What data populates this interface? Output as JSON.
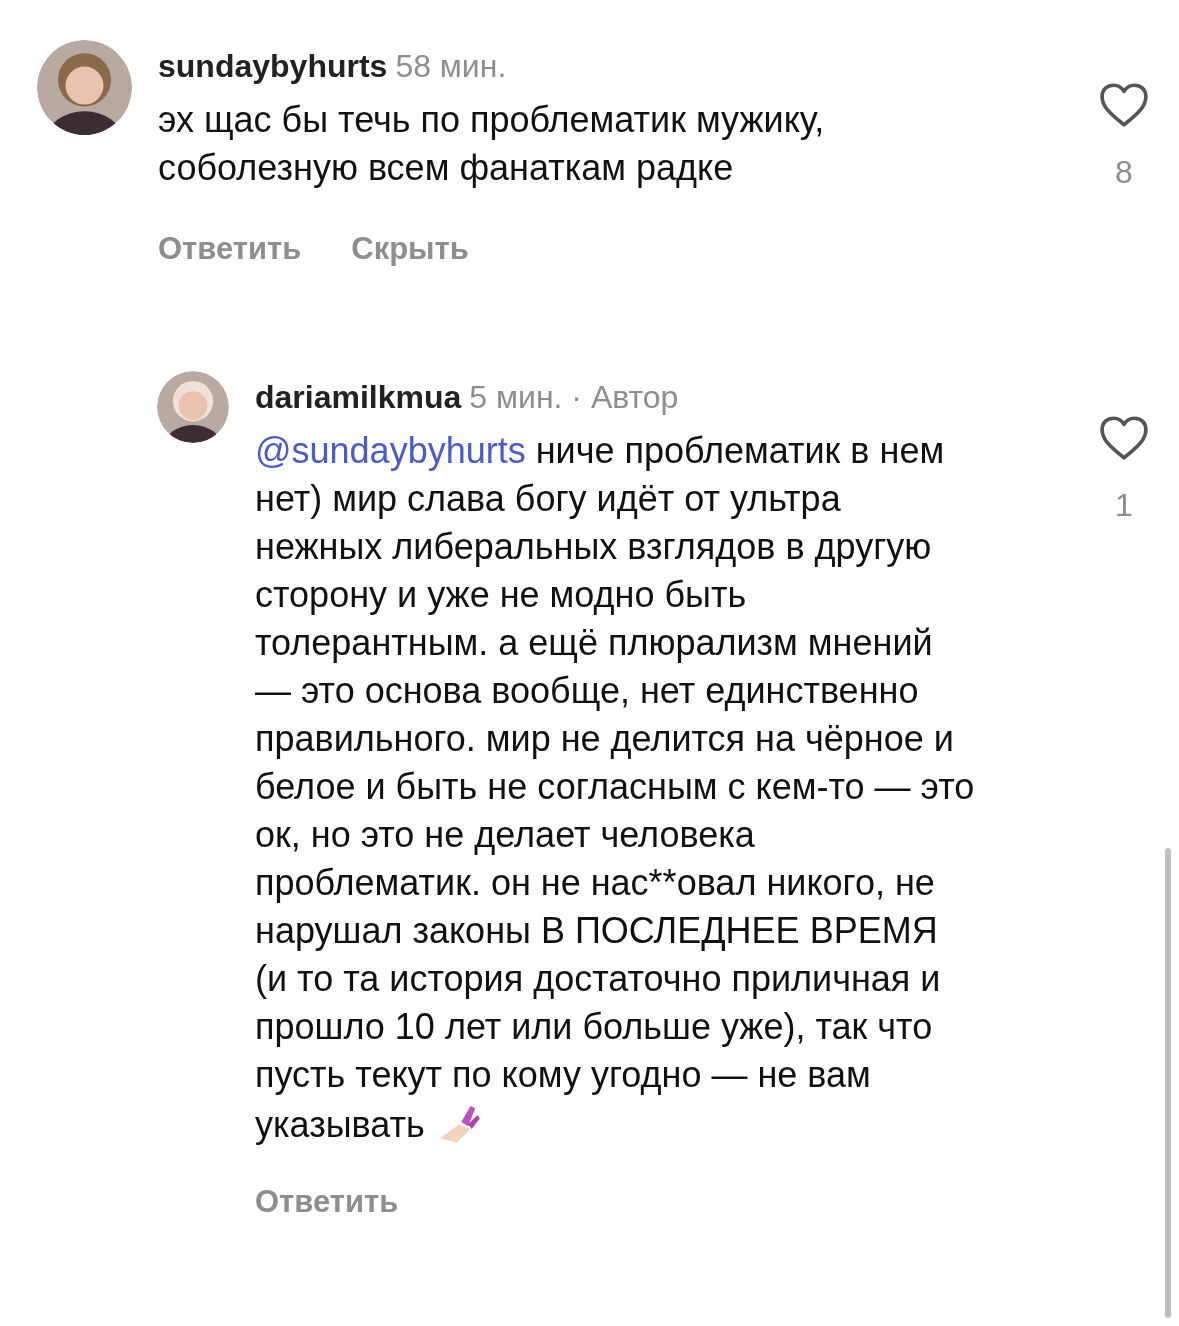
{
  "comments": [
    {
      "username": "sundaybyhurts",
      "meta": "58 мин.",
      "text": "эх щас бы течь по проблематик мужику, соболезную всем фанаткам радке",
      "likes": "8",
      "liked": false,
      "actions": [
        "Ответить",
        "Скрыть"
      ],
      "replies": [
        {
          "username": "dariamilkmua",
          "meta": "5 мин. · Автор",
          "mention": "@sundaybyhurts",
          "text": "ниче проблематик в нем нет) мир слава богу идёт от ультра нежных либеральных взглядов в другую сторону и уже не модно быть толерантным. а ещё плюрализм мнений — это основа вообще, нет единственно правильного. мир не делится на чёрное и белое и быть не согласным с кем-то — это ок, но это не делает человека проблематик. он не нас**овал никого, не нарушал законы В ПОСЛЕДНЕЕ ВРЕМЯ (и то та история достаточно приличная и прошло 10 лет или больше уже), так что пусть текут по кому угодно — не вам указывать",
          "likes": "1",
          "liked": false,
          "actions": [
            "Ответить"
          ]
        }
      ]
    }
  ]
}
